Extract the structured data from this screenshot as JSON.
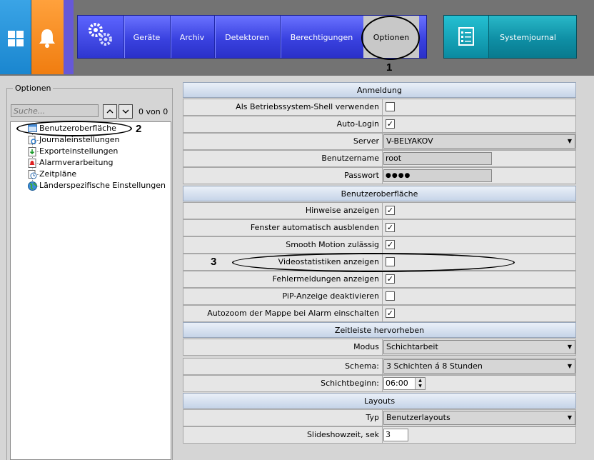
{
  "nav": {
    "items": [
      "Geräte",
      "Archiv",
      "Detektoren",
      "Berechtigungen",
      "Optionen"
    ],
    "system_journal": "Systemjournal",
    "icons": {
      "windows": "windows-icon",
      "bell": "bell-icon",
      "gears": "gears-icon",
      "journal": "journal-icon"
    }
  },
  "left_panel": {
    "title": "Optionen",
    "search_placeholder": "Suche...",
    "match_count": "0 von 0",
    "tree": [
      {
        "label": "Benutzeroberfläche",
        "icon": "window-icon"
      },
      {
        "label": "Journaleinstellungen",
        "icon": "journal-search-icon"
      },
      {
        "label": "Exporteinstellungen",
        "icon": "export-icon"
      },
      {
        "label": "Alarmverarbeitung",
        "icon": "alarm-icon"
      },
      {
        "label": "Zeitpläne",
        "icon": "clock-icon"
      },
      {
        "label": "Länderspezifische Einstellungen",
        "icon": "globe-icon"
      }
    ]
  },
  "annotations": {
    "m1": "1",
    "m2": "2",
    "m3": "3"
  },
  "sections": {
    "anmeldung": {
      "title": "Anmeldung",
      "shell": {
        "label": "Als Betriebssystem-Shell verwenden",
        "checked": false
      },
      "autologin": {
        "label": "Auto-Login",
        "checked": true
      },
      "server": {
        "label": "Server",
        "value": "V-BELYAKOV"
      },
      "username": {
        "label": "Benutzername",
        "value": "root"
      },
      "password": {
        "label": "Passwort",
        "value": "●●●●"
      }
    },
    "ui": {
      "title": "Benutzeroberfläche",
      "rows": [
        {
          "label": "Hinweise anzeigen",
          "checked": true
        },
        {
          "label": "Fenster automatisch ausblenden",
          "checked": true
        },
        {
          "label": "Smooth Motion zulässig",
          "checked": true
        },
        {
          "label": "Videostatistiken anzeigen",
          "checked": false
        },
        {
          "label": "Fehlermeldungen anzeigen",
          "checked": true
        },
        {
          "label": "PiP-Anzeige deaktivieren",
          "checked": false
        },
        {
          "label": "Autozoom der Mappe bei Alarm einschalten",
          "checked": true
        }
      ]
    },
    "timeline": {
      "title": "Zeitleiste hervorheben",
      "mode": {
        "label": "Modus",
        "value": "Schichtarbeit"
      },
      "scheme": {
        "label": "Schema:",
        "value": "3 Schichten á 8 Stunden"
      },
      "shift_start": {
        "label": "Schichtbeginn:",
        "value": "06:00"
      }
    },
    "layouts": {
      "title": "Layouts",
      "type": {
        "label": "Typ",
        "value": "Benutzerlayouts"
      },
      "slideshow": {
        "label": "Slideshowzeit, sek",
        "value": "3"
      }
    }
  },
  "check_glyph": "✓"
}
